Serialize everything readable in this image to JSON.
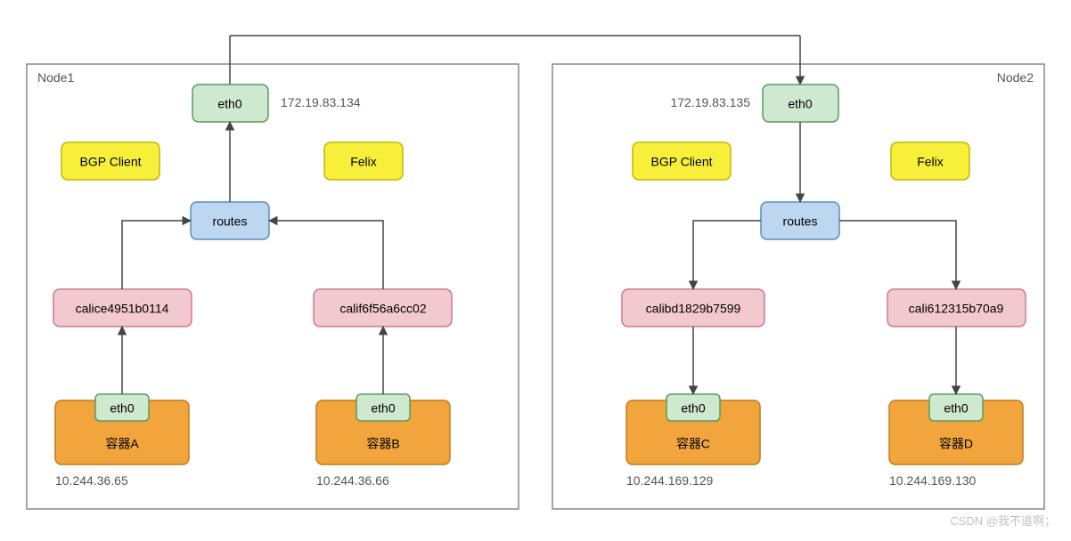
{
  "chart_data": {
    "type": "diagram",
    "title": "Calico networking between two nodes",
    "nodes": [
      {
        "name": "Node1",
        "host_interface": "eth0",
        "host_ip": "172.19.83.134",
        "components": [
          "BGP Client",
          "Felix"
        ],
        "router": "routes",
        "containers": [
          {
            "cali_iface": "calice4951b0114",
            "veth": "eth0",
            "name": "容器A",
            "ip": "10.244.36.65"
          },
          {
            "cali_iface": "calif6f56a6cc02",
            "veth": "eth0",
            "name": "容器B",
            "ip": "10.244.36.66"
          }
        ]
      },
      {
        "name": "Node2",
        "host_interface": "eth0",
        "host_ip": "172.19.83.135",
        "components": [
          "BGP Client",
          "Felix"
        ],
        "router": "routes",
        "containers": [
          {
            "cali_iface": "calibd1829b7599",
            "veth": "eth0",
            "name": "容器C",
            "ip": "10.244.169.129"
          },
          {
            "cali_iface": "cali612315b70a9",
            "veth": "eth0",
            "name": "容器D",
            "ip": "10.244.169.130"
          }
        ]
      }
    ],
    "edges": [
      [
        "Node1.eth0",
        "Node2.eth0"
      ],
      [
        "Node1.eth0",
        "Node1.routes"
      ],
      [
        "Node1.routes",
        "Node1.calice4951b0114"
      ],
      [
        "Node1.routes",
        "Node1.calif6f56a6cc02"
      ],
      [
        "Node1.容器A.eth0",
        "Node1.calice4951b0114"
      ],
      [
        "Node1.容器B.eth0",
        "Node1.calif6f56a6cc02"
      ],
      [
        "Node2.eth0",
        "Node2.routes"
      ],
      [
        "Node2.routes",
        "Node2.calibd1829b7599"
      ],
      [
        "Node2.routes",
        "Node2.cali612315b70a9"
      ],
      [
        "Node2.calibd1829b7599",
        "Node2.容器C.eth0"
      ],
      [
        "Node2.cali612315b70a9",
        "Node2.容器D.eth0"
      ]
    ]
  },
  "node1": {
    "title": "Node1",
    "eth0": "eth0",
    "host_ip": "172.19.83.134",
    "bgp": "BGP Client",
    "felix": "Felix",
    "routes": "routes",
    "cali_a": "calice4951b0114",
    "cali_b": "calif6f56a6cc02",
    "cont_a_eth": "eth0",
    "cont_a_name": "容器A",
    "cont_a_ip": "10.244.36.65",
    "cont_b_eth": "eth0",
    "cont_b_name": "容器B",
    "cont_b_ip": "10.244.36.66"
  },
  "node2": {
    "title": "Node2",
    "eth0": "eth0",
    "host_ip": "172.19.83.135",
    "bgp": "BGP Client",
    "felix": "Felix",
    "routes": "routes",
    "cali_c": "calibd1829b7599",
    "cali_d": "cali612315b70a9",
    "cont_c_eth": "eth0",
    "cont_c_name": "容器C",
    "cont_c_ip": "10.244.169.129",
    "cont_d_eth": "eth0",
    "cont_d_name": "容器D",
    "cont_d_ip": "10.244.169.130"
  },
  "watermark": "CSDN @我不道啊；"
}
